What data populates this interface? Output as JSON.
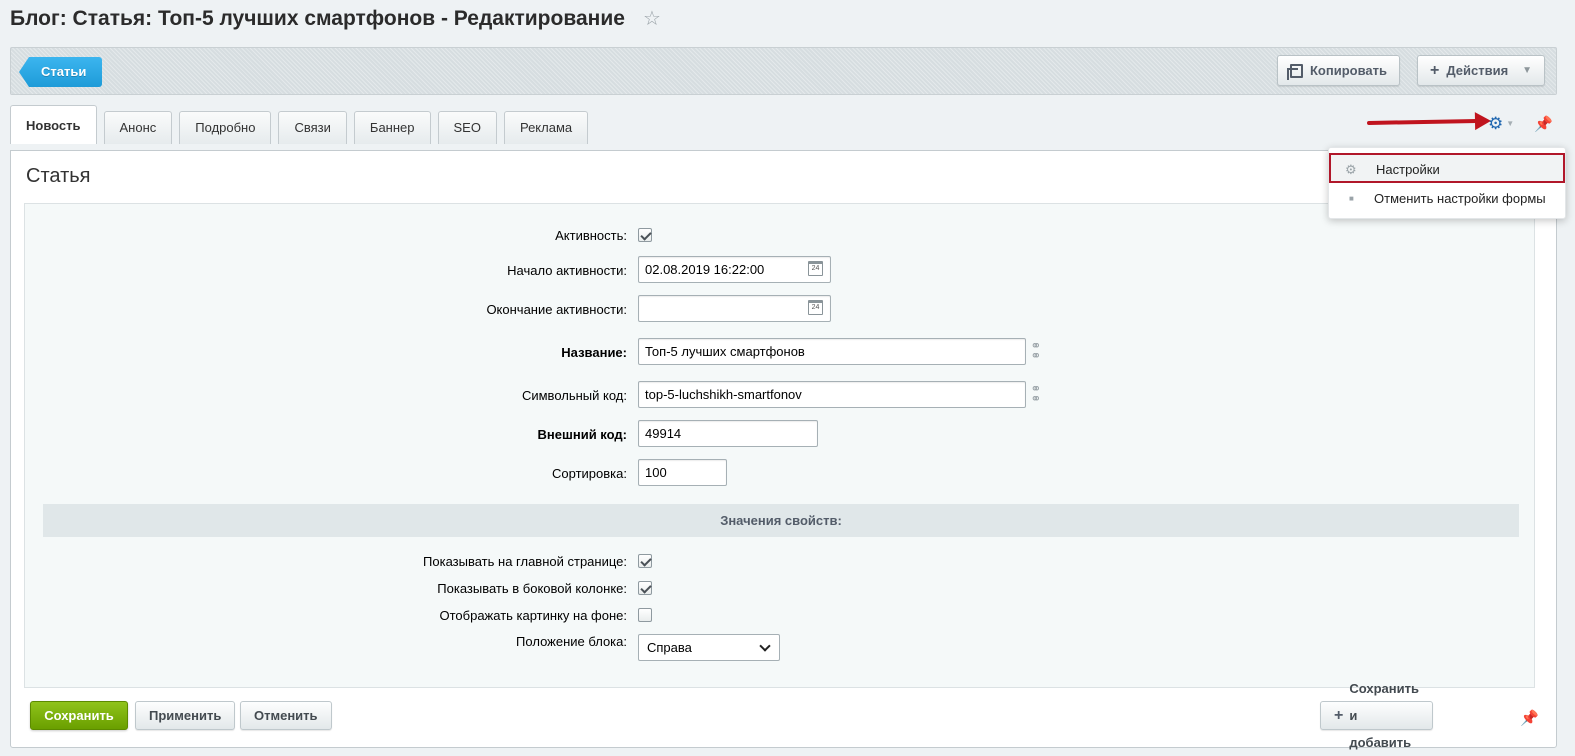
{
  "header": {
    "title": "Блог: Статья: Топ-5 лучших смартфонов - Редактирование"
  },
  "toolbar": {
    "back_label": "Статьи",
    "copy_label": "Копировать",
    "actions_label": "Действия"
  },
  "tabs": [
    {
      "label": "Новость"
    },
    {
      "label": "Анонс"
    },
    {
      "label": "Подробно"
    },
    {
      "label": "Связи"
    },
    {
      "label": "Баннер"
    },
    {
      "label": "SEO"
    },
    {
      "label": "Реклама"
    }
  ],
  "settings_menu": {
    "items": [
      {
        "label": "Настройки",
        "icon": "gear-icon"
      },
      {
        "label": "Отменить настройки формы",
        "icon": "bullet-icon"
      }
    ]
  },
  "panel": {
    "title": "Статья",
    "fields": {
      "active": {
        "label": "Активность:",
        "checked": true
      },
      "active_from": {
        "label": "Начало активности:",
        "value": "02.08.2019 16:22:00"
      },
      "active_to": {
        "label": "Окончание активности:",
        "value": ""
      },
      "name": {
        "label": "Название:",
        "value": "Топ-5 лучших смартфонов"
      },
      "code": {
        "label": "Символьный код:",
        "value": "top-5-luchshikh-smartfonov"
      },
      "xml_id": {
        "label": "Внешний код:",
        "value": "49914"
      },
      "sort": {
        "label": "Сортировка:",
        "value": "100"
      }
    },
    "properties_header": "Значения свойств:",
    "properties": {
      "show_main": {
        "label": "Показывать на главной странице:",
        "checked": true
      },
      "show_side": {
        "label": "Показывать в боковой колонке:",
        "checked": true
      },
      "bg_image": {
        "label": "Отображать картинку на фоне:",
        "checked": false
      },
      "position": {
        "label": "Положение блока:",
        "value": "Справа"
      }
    },
    "calendar_day": "24"
  },
  "footer": {
    "save_label": "Сохранить",
    "apply_label": "Применить",
    "cancel_label": "Отменить",
    "save_add_label": "Сохранить и добавить"
  }
}
